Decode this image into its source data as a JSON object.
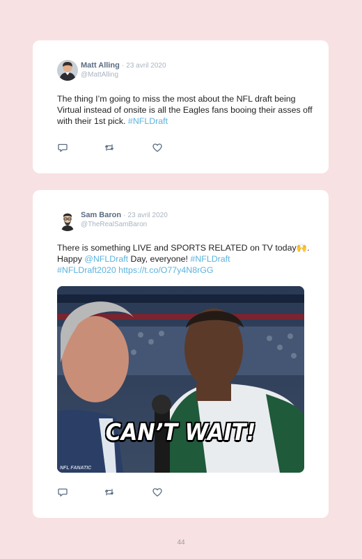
{
  "tweets": [
    {
      "author": "Matt Alling",
      "separator": "·",
      "date": "23 avril 2020",
      "handle": "@MattAlling",
      "text": "The thing I’m going to miss the most about the NFL draft being Virtual instead of onsite is all the Eagles fans booing their asses off with their 1st pick. ",
      "hashtag": "#NFLDraft",
      "avatar_icon": "avatar-photo"
    },
    {
      "author": "Sam Baron",
      "separator": "·",
      "date": "23 avril 2020",
      "handle": "@TheRealSamBaron",
      "text_a": "There is something LIVE and SPORTS RELATED on TV today",
      "emoji": "🙌",
      "text_b": ". Happy ",
      "mention": "@NFLDraft",
      "text_c": " Day, everyone! ",
      "hashtag1": "#NFLDraft",
      "hashtag2": "#NFLDraft2020",
      "url": "https://t.co/O77y4N8rGG",
      "media": {
        "caption": "CAN’T WAIT!",
        "watermark": "NFL FANATIC"
      },
      "avatar_icon": "avatar-illustration"
    }
  ],
  "actions": {
    "icons": [
      "reply-icon",
      "retweet-icon",
      "like-icon"
    ]
  },
  "colors": {
    "background": "#f8e1e3",
    "link": "#5bb2de",
    "author": "#5a6b82",
    "meta": "#aab4c1"
  },
  "page_number": "44"
}
